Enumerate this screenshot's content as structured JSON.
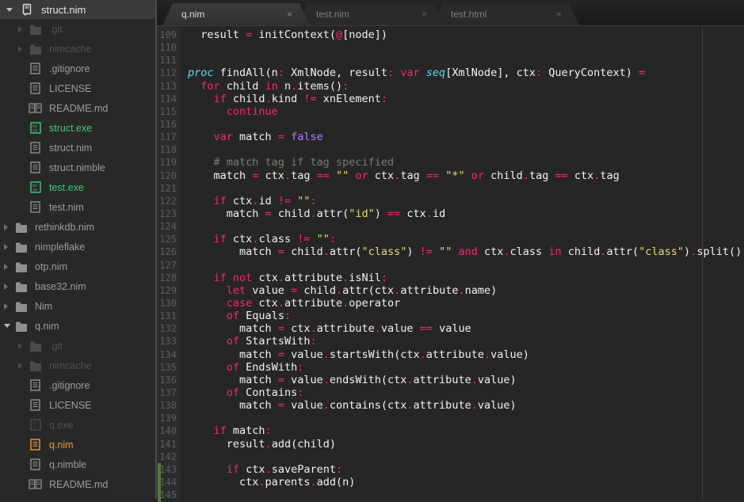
{
  "sidebar": {
    "header": {
      "label": "struct.nim"
    },
    "items": [
      {
        "label": ".git",
        "icon": "folder",
        "level": 1,
        "arrow": "right",
        "tone": "dim"
      },
      {
        "label": "nimcache",
        "icon": "folder",
        "level": 1,
        "arrow": "right",
        "tone": "dim"
      },
      {
        "label": ".gitignore",
        "icon": "file",
        "level": 1,
        "arrow": null,
        "tone": "normal"
      },
      {
        "label": "LICENSE",
        "icon": "file",
        "level": 1,
        "arrow": null,
        "tone": "normal"
      },
      {
        "label": "README.md",
        "icon": "book",
        "level": 1,
        "arrow": null,
        "tone": "normal"
      },
      {
        "label": "struct.exe",
        "icon": "exe",
        "level": 1,
        "arrow": null,
        "tone": "green"
      },
      {
        "label": "struct.nim",
        "icon": "file",
        "level": 1,
        "arrow": null,
        "tone": "normal"
      },
      {
        "label": "struct.nimble",
        "icon": "file",
        "level": 1,
        "arrow": null,
        "tone": "normal"
      },
      {
        "label": "test.exe",
        "icon": "exe",
        "level": 1,
        "arrow": null,
        "tone": "green"
      },
      {
        "label": "test.nim",
        "icon": "file",
        "level": 1,
        "arrow": null,
        "tone": "normal"
      },
      {
        "label": "rethinkdb.nim",
        "icon": "folder",
        "level": 0,
        "arrow": "right",
        "tone": "normal"
      },
      {
        "label": "nimpleflake",
        "icon": "folder",
        "level": 0,
        "arrow": "right",
        "tone": "normal"
      },
      {
        "label": "otp.nim",
        "icon": "folder",
        "level": 0,
        "arrow": "right",
        "tone": "normal"
      },
      {
        "label": "base32.nim",
        "icon": "folder",
        "level": 0,
        "arrow": "right",
        "tone": "normal"
      },
      {
        "label": "Nim",
        "icon": "folder",
        "level": 0,
        "arrow": "right",
        "tone": "normal"
      },
      {
        "label": "q.nim",
        "icon": "folder",
        "level": 0,
        "arrow": "down",
        "tone": "normal"
      },
      {
        "label": ".git",
        "icon": "folder",
        "level": 1,
        "arrow": "right",
        "tone": "dim"
      },
      {
        "label": "nimcache",
        "icon": "folder",
        "level": 1,
        "arrow": "right",
        "tone": "dim"
      },
      {
        "label": ".gitignore",
        "icon": "file",
        "level": 1,
        "arrow": null,
        "tone": "normal"
      },
      {
        "label": "LICENSE",
        "icon": "file",
        "level": 1,
        "arrow": null,
        "tone": "normal"
      },
      {
        "label": "q.exe",
        "icon": "exe",
        "level": 1,
        "arrow": null,
        "tone": "dim"
      },
      {
        "label": "q.nim",
        "icon": "file",
        "level": 1,
        "arrow": null,
        "tone": "orange"
      },
      {
        "label": "q.nimble",
        "icon": "file",
        "level": 1,
        "arrow": null,
        "tone": "normal"
      },
      {
        "label": "README.md",
        "icon": "book",
        "level": 1,
        "arrow": null,
        "tone": "normal"
      }
    ]
  },
  "tabbar": {
    "close_glyph": "×",
    "tabs": [
      {
        "label": "q.nim",
        "active": true
      },
      {
        "label": "test.nim",
        "active": false
      },
      {
        "label": "test.html",
        "active": false
      }
    ]
  },
  "editor": {
    "first_line_number": 109,
    "ruler_column": 80,
    "diff_marker": {
      "from_line": 143,
      "to_line": 145
    },
    "lines": [
      [
        [
          "p",
          "  result "
        ],
        [
          "k",
          "="
        ],
        [
          "p",
          " initContext("
        ],
        [
          "k",
          "@"
        ],
        [
          "p",
          "[node])"
        ]
      ],
      [],
      [],
      [
        [
          "t",
          "proc"
        ],
        [
          "p",
          " findAll(n"
        ],
        [
          "k",
          ":"
        ],
        [
          "p",
          " XmlNode, result"
        ],
        [
          "k",
          ":"
        ],
        [
          "p",
          " "
        ],
        [
          "k",
          "var"
        ],
        [
          "p",
          " "
        ],
        [
          "t",
          "seq"
        ],
        [
          "p",
          "[XmlNode], ctx"
        ],
        [
          "k",
          ":"
        ],
        [
          "p",
          " QueryContext) "
        ],
        [
          "k",
          "="
        ]
      ],
      [
        [
          "p",
          "  "
        ],
        [
          "k",
          "for"
        ],
        [
          "p",
          " child "
        ],
        [
          "k",
          "in"
        ],
        [
          "p",
          " n"
        ],
        [
          "k",
          "."
        ],
        [
          "p",
          "items()"
        ],
        [
          "k",
          ":"
        ]
      ],
      [
        [
          "p",
          "    "
        ],
        [
          "k",
          "if"
        ],
        [
          "p",
          " child"
        ],
        [
          "k",
          "."
        ],
        [
          "p",
          "kind "
        ],
        [
          "k",
          "!="
        ],
        [
          "p",
          " xnElement"
        ],
        [
          "k",
          ":"
        ]
      ],
      [
        [
          "p",
          "      "
        ],
        [
          "k",
          "continue"
        ]
      ],
      [],
      [
        [
          "p",
          "    "
        ],
        [
          "k",
          "var"
        ],
        [
          "p",
          " match "
        ],
        [
          "k",
          "="
        ],
        [
          "p",
          " "
        ],
        [
          "l",
          "false"
        ]
      ],
      [],
      [
        [
          "c",
          "    # match tag if tag specified"
        ]
      ],
      [
        [
          "p",
          "    match "
        ],
        [
          "k",
          "="
        ],
        [
          "p",
          " ctx"
        ],
        [
          "k",
          "."
        ],
        [
          "p",
          "tag "
        ],
        [
          "k",
          "=="
        ],
        [
          "p",
          " "
        ],
        [
          "s",
          "\"\""
        ],
        [
          "p",
          " "
        ],
        [
          "k",
          "or"
        ],
        [
          "p",
          " ctx"
        ],
        [
          "k",
          "."
        ],
        [
          "p",
          "tag "
        ],
        [
          "k",
          "=="
        ],
        [
          "p",
          " "
        ],
        [
          "s",
          "\"*\""
        ],
        [
          "p",
          " "
        ],
        [
          "k",
          "or"
        ],
        [
          "p",
          " child"
        ],
        [
          "k",
          "."
        ],
        [
          "p",
          "tag "
        ],
        [
          "k",
          "=="
        ],
        [
          "p",
          " ctx"
        ],
        [
          "k",
          "."
        ],
        [
          "p",
          "tag"
        ]
      ],
      [],
      [
        [
          "p",
          "    "
        ],
        [
          "k",
          "if"
        ],
        [
          "p",
          " ctx"
        ],
        [
          "k",
          "."
        ],
        [
          "p",
          "id "
        ],
        [
          "k",
          "!="
        ],
        [
          "p",
          " "
        ],
        [
          "s",
          "\"\""
        ],
        [
          "k",
          ":"
        ]
      ],
      [
        [
          "p",
          "      match "
        ],
        [
          "k",
          "="
        ],
        [
          "p",
          " child"
        ],
        [
          "k",
          "."
        ],
        [
          "p",
          "attr("
        ],
        [
          "s",
          "\"id\""
        ],
        [
          "p",
          ") "
        ],
        [
          "k",
          "=="
        ],
        [
          "p",
          " ctx"
        ],
        [
          "k",
          "."
        ],
        [
          "p",
          "id"
        ]
      ],
      [],
      [
        [
          "p",
          "    "
        ],
        [
          "k",
          "if"
        ],
        [
          "p",
          " ctx"
        ],
        [
          "k",
          "."
        ],
        [
          "p",
          "class "
        ],
        [
          "k",
          "!="
        ],
        [
          "p",
          " "
        ],
        [
          "s",
          "\"\""
        ],
        [
          "k",
          ":"
        ]
      ],
      [
        [
          "p",
          "        match "
        ],
        [
          "k",
          "="
        ],
        [
          "p",
          " child"
        ],
        [
          "k",
          "."
        ],
        [
          "p",
          "attr("
        ],
        [
          "s",
          "\"class\""
        ],
        [
          "p",
          ") "
        ],
        [
          "k",
          "!="
        ],
        [
          "p",
          " "
        ],
        [
          "s",
          "\"\""
        ],
        [
          "p",
          " "
        ],
        [
          "k",
          "and"
        ],
        [
          "p",
          " ctx"
        ],
        [
          "k",
          "."
        ],
        [
          "p",
          "class "
        ],
        [
          "k",
          "in"
        ],
        [
          "p",
          " child"
        ],
        [
          "k",
          "."
        ],
        [
          "p",
          "attr("
        ],
        [
          "s",
          "\"class\""
        ],
        [
          "p",
          ")"
        ],
        [
          "k",
          "."
        ],
        [
          "p",
          "split()"
        ]
      ],
      [],
      [
        [
          "p",
          "    "
        ],
        [
          "k",
          "if"
        ],
        [
          "p",
          " "
        ],
        [
          "k",
          "not"
        ],
        [
          "p",
          " ctx"
        ],
        [
          "k",
          "."
        ],
        [
          "p",
          "attribute"
        ],
        [
          "k",
          "."
        ],
        [
          "p",
          "isNil"
        ],
        [
          "k",
          ":"
        ]
      ],
      [
        [
          "p",
          "      "
        ],
        [
          "k",
          "let"
        ],
        [
          "p",
          " value "
        ],
        [
          "k",
          "="
        ],
        [
          "p",
          " child"
        ],
        [
          "k",
          "."
        ],
        [
          "p",
          "attr(ctx"
        ],
        [
          "k",
          "."
        ],
        [
          "p",
          "attribute"
        ],
        [
          "k",
          "."
        ],
        [
          "p",
          "name)"
        ]
      ],
      [
        [
          "p",
          "      "
        ],
        [
          "k",
          "case"
        ],
        [
          "p",
          " ctx"
        ],
        [
          "k",
          "."
        ],
        [
          "p",
          "attribute"
        ],
        [
          "k",
          "."
        ],
        [
          "p",
          "operator"
        ]
      ],
      [
        [
          "p",
          "      "
        ],
        [
          "k",
          "of"
        ],
        [
          "p",
          " Equals"
        ],
        [
          "k",
          ":"
        ]
      ],
      [
        [
          "p",
          "        match "
        ],
        [
          "k",
          "="
        ],
        [
          "p",
          " ctx"
        ],
        [
          "k",
          "."
        ],
        [
          "p",
          "attribute"
        ],
        [
          "k",
          "."
        ],
        [
          "p",
          "value "
        ],
        [
          "k",
          "=="
        ],
        [
          "p",
          " value"
        ]
      ],
      [
        [
          "p",
          "      "
        ],
        [
          "k",
          "of"
        ],
        [
          "p",
          " StartsWith"
        ],
        [
          "k",
          ":"
        ]
      ],
      [
        [
          "p",
          "        match "
        ],
        [
          "k",
          "="
        ],
        [
          "p",
          " value"
        ],
        [
          "k",
          "."
        ],
        [
          "p",
          "startsWith(ctx"
        ],
        [
          "k",
          "."
        ],
        [
          "p",
          "attribute"
        ],
        [
          "k",
          "."
        ],
        [
          "p",
          "value)"
        ]
      ],
      [
        [
          "p",
          "      "
        ],
        [
          "k",
          "of"
        ],
        [
          "p",
          " EndsWith"
        ],
        [
          "k",
          ":"
        ]
      ],
      [
        [
          "p",
          "        match "
        ],
        [
          "k",
          "="
        ],
        [
          "p",
          " value"
        ],
        [
          "k",
          "."
        ],
        [
          "p",
          "endsWith(ctx"
        ],
        [
          "k",
          "."
        ],
        [
          "p",
          "attribute"
        ],
        [
          "k",
          "."
        ],
        [
          "p",
          "value)"
        ]
      ],
      [
        [
          "p",
          "      "
        ],
        [
          "k",
          "of"
        ],
        [
          "p",
          " Contains"
        ],
        [
          "k",
          ":"
        ]
      ],
      [
        [
          "p",
          "        match "
        ],
        [
          "k",
          "="
        ],
        [
          "p",
          " value"
        ],
        [
          "k",
          "."
        ],
        [
          "p",
          "contains(ctx"
        ],
        [
          "k",
          "."
        ],
        [
          "p",
          "attribute"
        ],
        [
          "k",
          "."
        ],
        [
          "p",
          "value)"
        ]
      ],
      [],
      [
        [
          "p",
          "    "
        ],
        [
          "k",
          "if"
        ],
        [
          "p",
          " match"
        ],
        [
          "k",
          ":"
        ]
      ],
      [
        [
          "p",
          "      result"
        ],
        [
          "k",
          "."
        ],
        [
          "p",
          "add(child)"
        ]
      ],
      [],
      [
        [
          "p",
          "      "
        ],
        [
          "k",
          "if"
        ],
        [
          "p",
          " ctx"
        ],
        [
          "k",
          "."
        ],
        [
          "p",
          "saveParent"
        ],
        [
          "k",
          ":"
        ]
      ],
      [
        [
          "p",
          "        ctx"
        ],
        [
          "k",
          "."
        ],
        [
          "p",
          "parents"
        ],
        [
          "k",
          "."
        ],
        [
          "p",
          "add(n)"
        ]
      ],
      []
    ]
  },
  "colors": {
    "keyword": "#f92672",
    "type": "#66d9ef",
    "string": "#e6db74",
    "comment": "#7b7b73",
    "literal": "#ae81ff",
    "plain": "#f2f2f2",
    "exe_green": "#42c97b",
    "active_file_orange": "#e89b3c",
    "diff_green": "#5b7a3d",
    "dim": "#525252"
  }
}
